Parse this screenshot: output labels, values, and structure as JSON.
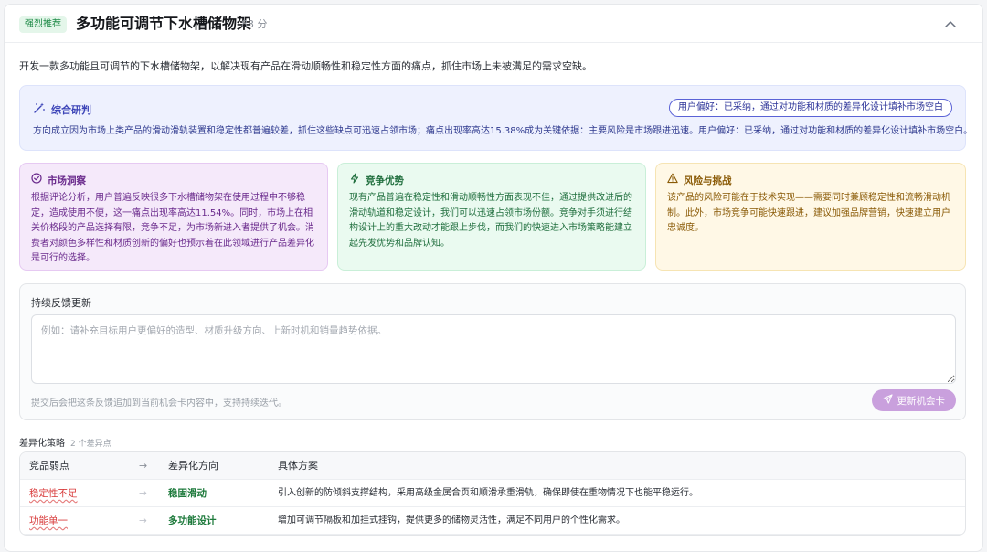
{
  "header": {
    "badge": "强烈推荐",
    "title": "多功能可调节下水槽储物架",
    "score": "83 分"
  },
  "intro": "开发一款多功能且可调节的下水槽储物架，以解决现有产品在滑动顺畅性和稳定性方面的痛点，抓住市场上未被满足的需求空缺。",
  "synthesis": {
    "title": "综合研判",
    "preference_pill": "用户偏好：已采纳，通过对功能和材质的差异化设计填补市场空白",
    "body": "方向成立因为市场上类产品的滑动滑轨装置和稳定性都普遍较差，抓住这些缺点可迅速占领市场；痛点出现率高达15.38%成为关键依据：主要风险是市场跟进迅速。用户偏好：已采纳，通过对功能和材质的差异化设计填补市场空白。"
  },
  "insights": [
    {
      "title": "市场洞察",
      "icon": "target-check-icon",
      "body": "根据评论分析，用户普遍反映很多下水槽储物架在使用过程中不够稳定，造成使用不便，这一痛点出现率高达11.54%。同时，市场上在相关价格段的产品选择有限，竞争不足，为市场新进入者提供了机会。消费者对颜色多样性和材质创新的偏好也预示着在此领域进行产品差异化是可行的选择。"
    },
    {
      "title": "竞争优势",
      "icon": "lightning-icon",
      "body": "现有产品普遍在稳定性和滑动顺畅性方面表现不佳，通过提供改进后的滑动轨道和稳定设计，我们可以迅速占领市场份额。竞争对手须进行结构设计上的重大改动才能跟上步伐，而我们的快速进入市场策略能建立起先发优势和品牌认知。"
    },
    {
      "title": "风险与挑战",
      "icon": "warning-icon",
      "body": "该产品的风险可能在于技术实现——需要同时兼顾稳定性和流畅滑动机制。此外，市场竞争可能快速跟进，建议加强品牌营销，快速建立用户忠诚度。"
    }
  ],
  "feedback": {
    "label": "持续反馈更新",
    "placeholder": "例如：请补充目标用户更偏好的造型、材质升级方向、上新时机和销量趋势依据。",
    "hint": "提交后会把这条反馈追加到当前机会卡内容中，支持持续迭代。",
    "button": "更新机会卡"
  },
  "strategy": {
    "title": "差异化策略",
    "count": "2 个差异点",
    "columns": [
      "竞品弱点",
      "→",
      "差异化方向",
      "具体方案"
    ],
    "rows": [
      {
        "weakness": "稳定性不足",
        "arrow": "→",
        "direction": "稳固滑动",
        "plan": "引入创新的防倾斜支撑结构，采用高级金属合页和顺滑承重滑轨，确保即使在重物情况下也能平稳运行。"
      },
      {
        "weakness": "功能单一",
        "arrow": "→",
        "direction": "多功能设计",
        "plan": "增加可调节隔板和加挂式挂钩，提供更多的储物灵活性，满足不同用户的个性化需求。"
      }
    ]
  },
  "colors": {
    "badge_bg": "#e4f6ea",
    "synth_bg": "#eef1fe",
    "insight_market_bg": "#f5e9fa",
    "insight_advantage_bg": "#eafaf0",
    "insight_risk_bg": "#fff8e6",
    "button_bg": "#c9a0dd",
    "weakness_text": "#d83a3a",
    "direction_text": "#1e7a3c"
  }
}
